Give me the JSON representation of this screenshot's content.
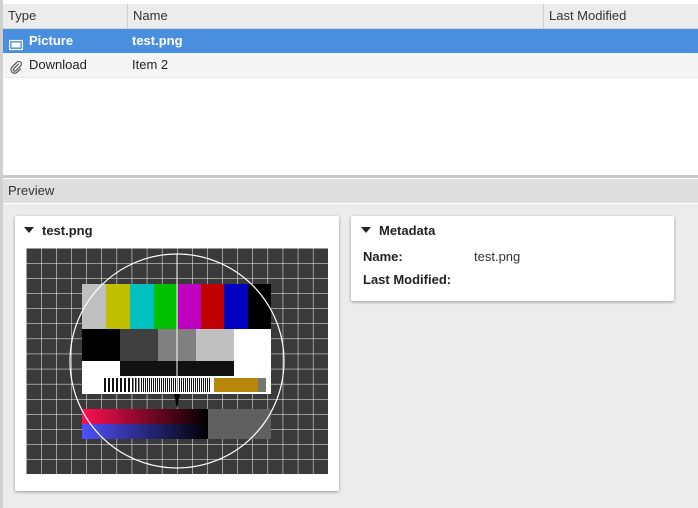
{
  "table": {
    "columns": [
      "Type",
      "Name",
      "Last Modified"
    ],
    "rows": [
      {
        "type": "Picture",
        "name": "test.png",
        "modified": "",
        "icon": "picture-icon",
        "selected": true
      },
      {
        "type": "Download",
        "name": "Item 2",
        "modified": "",
        "icon": "paperclip-icon",
        "selected": false
      }
    ]
  },
  "preview": {
    "label": "Preview",
    "image_card": {
      "title": "test.png",
      "image": "tv-test-pattern"
    },
    "metadata_card": {
      "title": "Metadata",
      "name_label": "Name:",
      "name_value": "test.png",
      "modified_label": "Last Modified:",
      "modified_value": ""
    }
  },
  "colors": {
    "selection": "#4a8fde",
    "header_bg": "#ececec",
    "pane_bg": "#ececec"
  }
}
